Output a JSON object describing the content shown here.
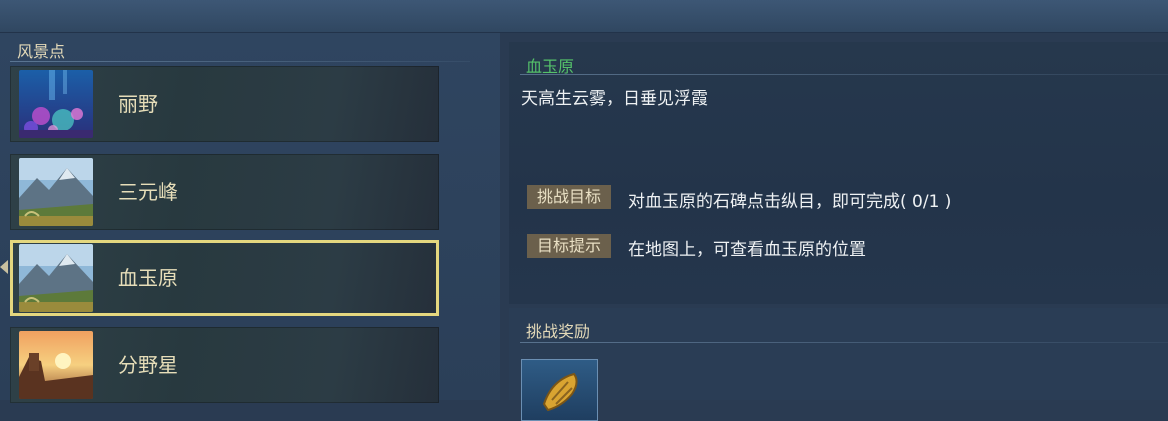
{
  "scenic": {
    "title": "风景点",
    "items": [
      {
        "label": "丽野",
        "thumb": "coral-reef-thumbnail",
        "selected": false
      },
      {
        "label": "三元峰",
        "thumb": "mountain-valley-thumbnail",
        "selected": false
      },
      {
        "label": "血玉原",
        "thumb": "mountain-valley-thumbnail",
        "selected": true
      },
      {
        "label": "分野星",
        "thumb": "sunset-rocks-thumbnail",
        "selected": false
      }
    ]
  },
  "detail": {
    "name": "血玉原",
    "description": "天高生云雾，日垂见浮霞",
    "challenge_tag": "挑战目标",
    "challenge_text": "对血玉原的石碑点击纵目，即可完成( 0/1 )",
    "hint_tag": "目标提示",
    "hint_text": "在地图上，可查看血玉原的位置"
  },
  "reward": {
    "title": "挑战奖励",
    "item_icon": "golden-shell-icon"
  },
  "colors": {
    "accent_green": "#55c26a",
    "selected_border": "#e4d77f",
    "label_gold": "#e7deb9"
  }
}
